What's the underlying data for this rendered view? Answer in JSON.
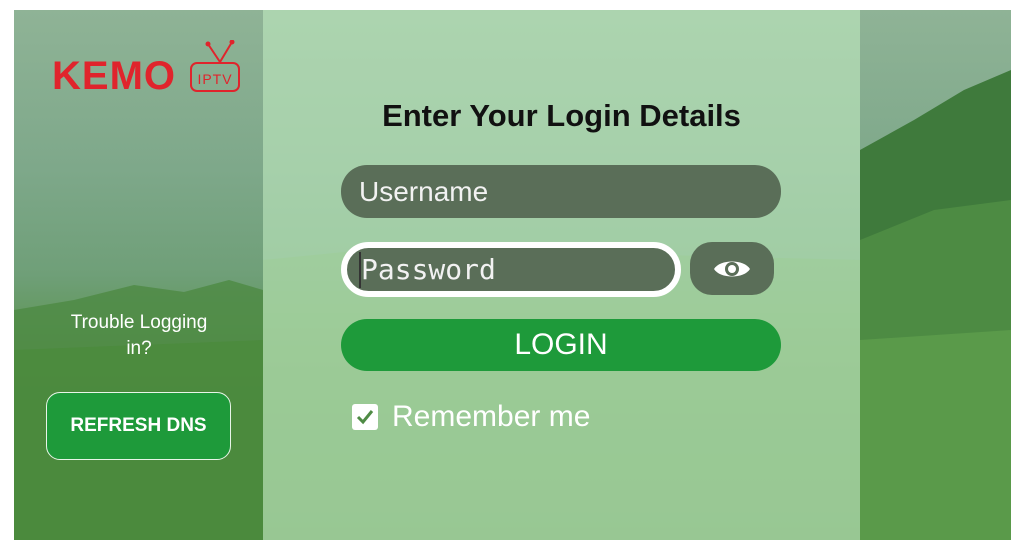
{
  "brand": {
    "name": "KEMO",
    "badge": "IPTV",
    "color": "#e0242c"
  },
  "sidebar": {
    "trouble_text": "Trouble Logging in?",
    "refresh_label": "REFRESH DNS"
  },
  "login": {
    "heading": "Enter Your Login Details",
    "username_placeholder": "Username",
    "password_placeholder": "Password",
    "show_password_icon": "eye-icon",
    "submit_label": "LOGIN",
    "remember_label": "Remember me",
    "remember_checked": true
  },
  "colors": {
    "accent_green": "#1e9a3a",
    "field_bg": "#5a6e58"
  }
}
